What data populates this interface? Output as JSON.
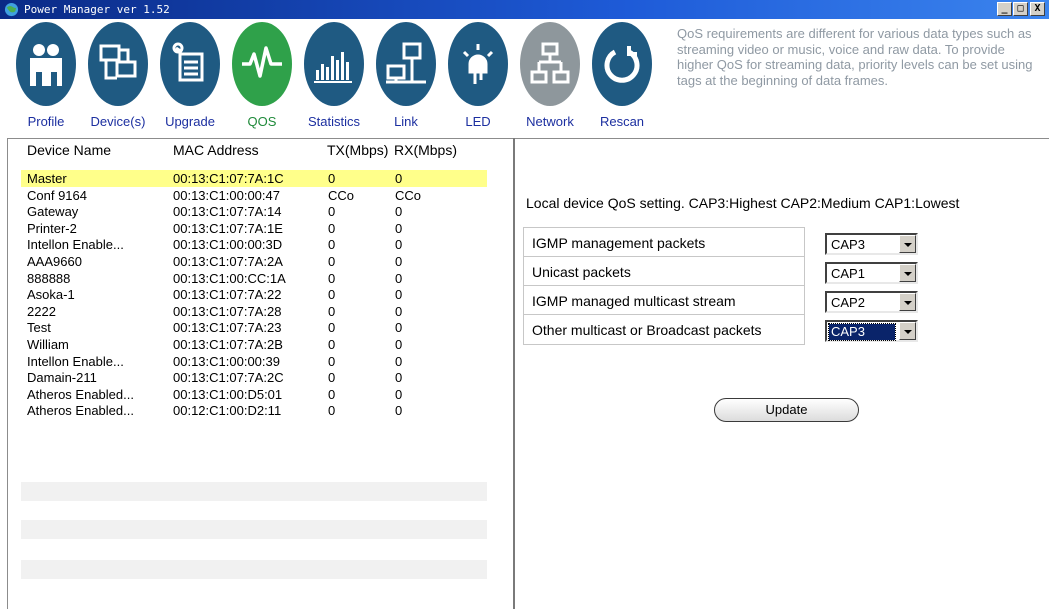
{
  "window": {
    "title": "Power Manager ver 1.52",
    "min_glyph": "_",
    "max_glyph": "□",
    "close_glyph": "X"
  },
  "toolbar": [
    {
      "label": "Profile",
      "icon": "people-icon"
    },
    {
      "label": "Device(s)",
      "icon": "devices-icon"
    },
    {
      "label": "Upgrade",
      "icon": "upgrade-icon"
    },
    {
      "label": "QOS",
      "icon": "qos-pulse-icon",
      "active": true
    },
    {
      "label": "Statistics",
      "icon": "statistics-icon"
    },
    {
      "label": "Link",
      "icon": "link-icon"
    },
    {
      "label": "LED",
      "icon": "led-icon"
    },
    {
      "label": "Network",
      "icon": "network-icon",
      "disabled": true
    },
    {
      "label": "Rescan",
      "icon": "rescan-icon"
    }
  ],
  "info_text": "QoS requirements are different for various data types such as streaming video or music, voice and raw data. To provide higher QoS for streaming data, priority levels can be set using tags at the beginning of data frames.",
  "device_table": {
    "headers": {
      "name": "Device Name",
      "mac": "MAC Address",
      "tx": "TX(Mbps)",
      "rx": "RX(Mbps)"
    },
    "rows": [
      {
        "name": "Master",
        "mac": "00:13:C1:07:7A:1C",
        "tx": "0",
        "rx": "0",
        "selected": true
      },
      {
        "name": "Conf 9164",
        "mac": "00:13:C1:00:00:47",
        "tx": "CCo",
        "rx": "CCo"
      },
      {
        "name": "Gateway",
        "mac": "00:13:C1:07:7A:14",
        "tx": "0",
        "rx": "0"
      },
      {
        "name": "Printer-2",
        "mac": "00:13:C1:07:7A:1E",
        "tx": "0",
        "rx": "0"
      },
      {
        "name": "Intellon Enable...",
        "mac": "00:13:C1:00:00:3D",
        "tx": "0",
        "rx": "0"
      },
      {
        "name": "AAA9660",
        "mac": "00:13:C1:07:7A:2A",
        "tx": "0",
        "rx": "0"
      },
      {
        "name": "888888",
        "mac": "00:13:C1:00:CC:1A",
        "tx": "0",
        "rx": "0"
      },
      {
        "name": "Asoka-1",
        "mac": "00:13:C1:07:7A:22",
        "tx": "0",
        "rx": "0"
      },
      {
        "name": "2222",
        "mac": "00:13:C1:07:7A:28",
        "tx": "0",
        "rx": "0"
      },
      {
        "name": "Test",
        "mac": "00:13:C1:07:7A:23",
        "tx": "0",
        "rx": "0"
      },
      {
        "name": "William",
        "mac": "00:13:C1:07:7A:2B",
        "tx": "0",
        "rx": "0"
      },
      {
        "name": "Intellon Enable...",
        "mac": "00:13:C1:00:00:39",
        "tx": "0",
        "rx": "0"
      },
      {
        "name": "Damain-211",
        "mac": "00:13:C1:07:7A:2C",
        "tx": "0",
        "rx": "0"
      },
      {
        "name": "Atheros Enabled...",
        "mac": "00:13:C1:00:D5:01",
        "tx": "0",
        "rx": "0"
      },
      {
        "name": "Atheros Enabled...",
        "mac": "00:12:C1:00:D2:11",
        "tx": "0",
        "rx": "0"
      }
    ]
  },
  "qos": {
    "caption": "Local device QoS setting. CAP3:Highest CAP2:Medium CAP1:Lowest",
    "settings": [
      {
        "label": "IGMP management packets",
        "value": "CAP3"
      },
      {
        "label": "Unicast packets",
        "value": "CAP1"
      },
      {
        "label": "IGMP managed multicast stream",
        "value": "CAP2"
      },
      {
        "label": "Other multicast or Broadcast packets",
        "value": "CAP3",
        "focused": true
      }
    ],
    "update_label": "Update"
  },
  "colors": {
    "title_bar": "#1e5bd8",
    "icon_circle": "#1f5a82",
    "icon_active": "#2fa14a",
    "icon_disabled": "#8e979c",
    "selected_row": "#ffff8a",
    "label_blue": "#1c2fa0"
  }
}
